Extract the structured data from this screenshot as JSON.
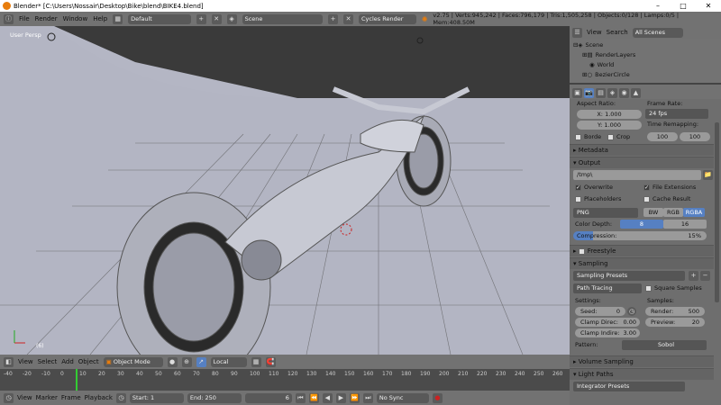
{
  "window": {
    "title": "Blender* [C:\\Users\\Nossair\\Desktop\\Bike\\blend\\BIKE4.blend]"
  },
  "topmenu": {
    "file": "File",
    "render": "Render",
    "window": "Window",
    "help": "Help"
  },
  "layout": {
    "name": "Default",
    "scene": "Scene",
    "engine": "Cycles Render"
  },
  "stats": "v2.75 | Verts:945,242 | Faces:796,179 | Tris:1,505,258 | Objects:0/128 | Lamps:0/5 | Mem:408.50M",
  "viewport": {
    "label": "User Persp",
    "frame_label": "(6)"
  },
  "outliner": {
    "view": "View",
    "search": "Search",
    "all_scenes": "All Scenes",
    "items": [
      "Scene",
      "RenderLayers",
      "World",
      "BezierCircle"
    ]
  },
  "properties": {
    "aspect_label": "Aspect Ratio:",
    "framerate_label": "Frame Rate:",
    "x_label": "X:",
    "x_val": "1.000",
    "y_label": "Y:",
    "y_val": "1.000",
    "fps": "24 fps",
    "time_remap": "Time Remapping:",
    "remap_old": "100",
    "remap_new": "100",
    "border": "Borde",
    "crop": "Crop",
    "metadata": "Metadata",
    "output": "Output",
    "path": "/tmp\\",
    "overwrite": "Overwrite",
    "file_ext": "File Extensions",
    "placeholders": "Placeholders",
    "cache_result": "Cache Result",
    "format": "PNG",
    "bw": "BW",
    "rgb": "RGB",
    "rgba": "RGBA",
    "color_depth": "Color Depth:",
    "depth8": "8",
    "depth16": "16",
    "compression": "Compression:",
    "compression_val": "15%",
    "freestyle": "Freestyle",
    "sampling": "Sampling",
    "sampling_presets": "Sampling Presets",
    "path_tracing": "Path Tracing",
    "square_samples": "Square Samples",
    "settings": "Settings:",
    "samples": "Samples:",
    "seed": "Seed:",
    "seed_val": "0",
    "render": "Render:",
    "render_val": "500",
    "clamp_direct": "Clamp Direc:",
    "clamp_direct_val": "0.00",
    "preview": "Preview:",
    "preview_val": "20",
    "clamp_indirect": "Clamp Indire:",
    "clamp_indirect_val": "3.00",
    "pattern": "Pattern:",
    "pattern_val": "Sobol",
    "volume_sampling": "Volume Sampling",
    "light_paths": "Light Paths",
    "integrator_presets": "Integrator Presets"
  },
  "viewbar": {
    "view": "View",
    "select": "Select",
    "add": "Add",
    "object": "Object",
    "mode": "Object Mode",
    "orient": "Local"
  },
  "timeline": {
    "ticks": [
      "-40",
      "-20",
      "-10",
      "0",
      "10",
      "20",
      "30",
      "40",
      "50",
      "60",
      "70",
      "80",
      "90",
      "100",
      "110",
      "120",
      "130",
      "140",
      "150",
      "160",
      "170",
      "180",
      "190",
      "200",
      "210",
      "220",
      "230",
      "240",
      "250",
      "260"
    ]
  },
  "tlbar": {
    "view": "View",
    "marker": "Marker",
    "frame": "Frame",
    "playback": "Playback",
    "start_label": "Start:",
    "start": "1",
    "end_label": "End:",
    "end": "250",
    "current": "6",
    "sync": "No Sync"
  },
  "colors": {
    "accent": "#5680c2",
    "orange": "#e87d0d"
  }
}
